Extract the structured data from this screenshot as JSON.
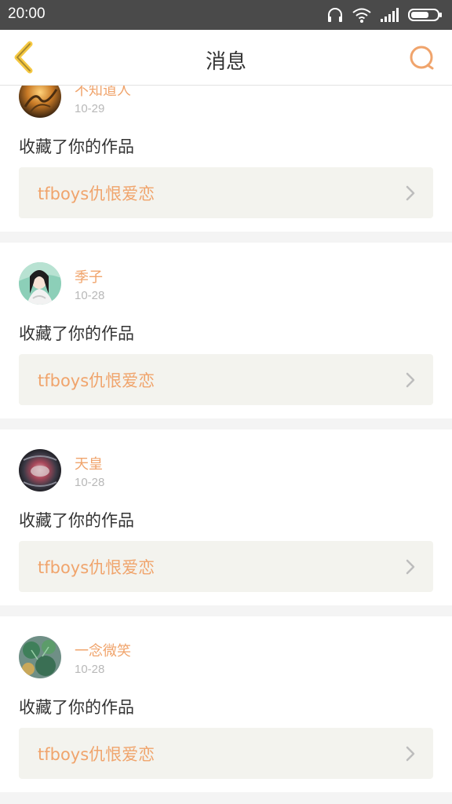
{
  "status_bar": {
    "time": "20:00",
    "icons": [
      "headphones-icon",
      "wifi-icon",
      "signal-icon",
      "battery-icon"
    ]
  },
  "header": {
    "title": "消息",
    "back_icon": "chevron-left-icon",
    "search_icon": "search-icon"
  },
  "colors": {
    "accent": "#f0a46c",
    "back_accent": "#f5c842",
    "status_bar_bg": "#4a4a4a",
    "card_link_bg": "#f3f3ee"
  },
  "messages": [
    {
      "user": "不知道人",
      "date": "10-29",
      "action": "收藏了你的作品",
      "work": "tfboys仇恨爱恋"
    },
    {
      "user": "季子",
      "date": "10-28",
      "action": "收藏了你的作品",
      "work": "tfboys仇恨爱恋"
    },
    {
      "user": "天皇",
      "date": "10-28",
      "action": "收藏了你的作品",
      "work": "tfboys仇恨爱恋"
    },
    {
      "user": "一念微笑",
      "date": "10-28",
      "action": "收藏了你的作品",
      "work": "tfboys仇恨爱恋"
    }
  ]
}
